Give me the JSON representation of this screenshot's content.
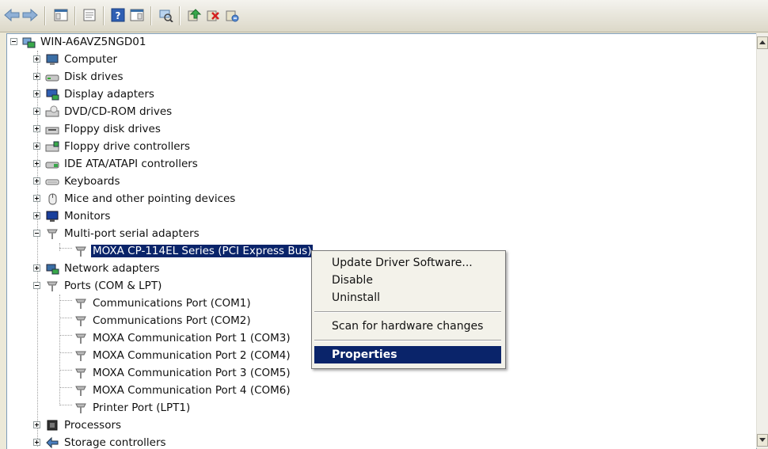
{
  "toolbar": {
    "icons": [
      "back-arrow-icon",
      "forward-arrow-icon",
      "show-hide-console-tree-icon",
      "properties-icon",
      "help-icon",
      "action-pane-icon",
      "scan-hardware-icon",
      "update-driver-icon",
      "uninstall-icon",
      "disable-icon"
    ]
  },
  "tree": {
    "root": "WIN-A6AVZ5NGD01",
    "items": [
      {
        "label": "Computer"
      },
      {
        "label": "Disk drives"
      },
      {
        "label": "Display adapters"
      },
      {
        "label": "DVD/CD-ROM drives"
      },
      {
        "label": "Floppy disk drives"
      },
      {
        "label": "Floppy drive controllers"
      },
      {
        "label": "IDE ATA/ATAPI controllers"
      },
      {
        "label": "Keyboards"
      },
      {
        "label": "Mice and other pointing devices"
      },
      {
        "label": "Monitors"
      },
      {
        "label": "Multi-port serial adapters"
      },
      {
        "label": "MOXA CP-114EL Series (PCI Express Bus)"
      },
      {
        "label": "Network adapters"
      },
      {
        "label": "Ports (COM & LPT)"
      },
      {
        "label": "Communications Port (COM1)"
      },
      {
        "label": "Communications Port (COM2)"
      },
      {
        "label": "MOXA Communication Port 1 (COM3)"
      },
      {
        "label": "MOXA Communication Port 2 (COM4)"
      },
      {
        "label": "MOXA Communication Port 3 (COM5)"
      },
      {
        "label": "MOXA Communication Port 4 (COM6)"
      },
      {
        "label": "Printer Port (LPT1)"
      },
      {
        "label": "Processors"
      },
      {
        "label": "Storage controllers"
      }
    ]
  },
  "context_menu": {
    "items": [
      {
        "label": "Update Driver Software..."
      },
      {
        "label": "Disable"
      },
      {
        "label": "Uninstall"
      },
      {
        "label": "Scan for hardware changes"
      },
      {
        "label": "Properties"
      }
    ]
  },
  "colors": {
    "selection": "#0a246a",
    "toolbar": "#ece9d8"
  }
}
